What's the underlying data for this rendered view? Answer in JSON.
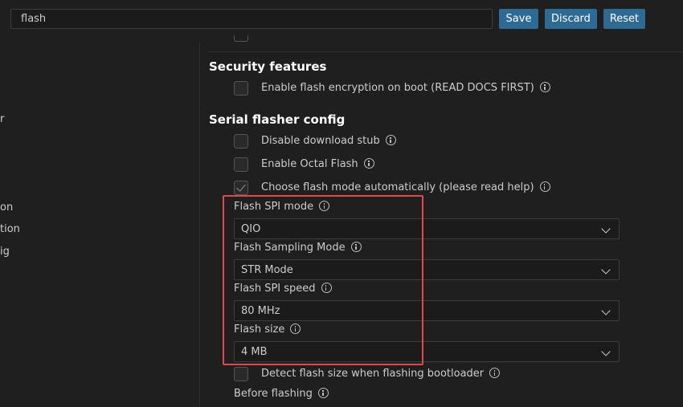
{
  "header": {
    "search_value": "flash",
    "save_label": "Save",
    "discard_label": "Discard",
    "reset_label": "Reset"
  },
  "sidebar": {
    "fragments": [
      "r",
      "on",
      "tion",
      "ig"
    ]
  },
  "sections": {
    "security_title": "Security features",
    "security_items": [
      {
        "label": "Enable flash encryption on boot (READ DOCS FIRST)",
        "checked": false
      }
    ],
    "serial_title": "Serial flasher config",
    "serial_items": [
      {
        "label": "Disable download stub",
        "checked": false
      },
      {
        "label": "Enable Octal Flash",
        "checked": false
      },
      {
        "label": "Choose flash mode automatically (please read help)",
        "checked": true
      }
    ],
    "fields": [
      {
        "label": "Flash SPI mode",
        "value": "QIO"
      },
      {
        "label": "Flash Sampling Mode",
        "value": "STR Mode"
      },
      {
        "label": "Flash SPI speed",
        "value": "80 MHz"
      },
      {
        "label": "Flash size",
        "value": "4 MB"
      }
    ],
    "detect_item": {
      "label": "Detect flash size when flashing bootloader",
      "checked": false
    },
    "before_flashing_label": "Before flashing"
  },
  "colors": {
    "accent_button": "#2d6b94",
    "highlight_box": "#e0494a",
    "background": "#1f1f1f"
  }
}
